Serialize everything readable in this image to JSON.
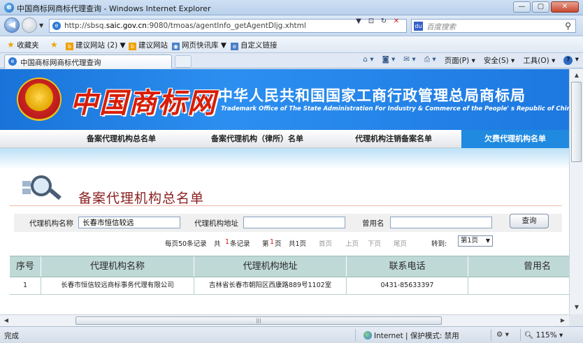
{
  "window": {
    "title": "中国商标网商标代理查询 - Windows Internet Explorer",
    "minimize": "—",
    "restore": "▢",
    "close": "✕"
  },
  "address": {
    "url_prefix": "http://sbsq.",
    "url_host": "saic.gov.cn",
    "url_rest": ":9080/tmoas/agentInfo_getAgentDljg.xhtml",
    "search_placeholder": "百度搜索"
  },
  "favorites": {
    "favorites_label": "收藏夹",
    "items": [
      {
        "label": "建议网站 (2)",
        "icon": "b-icon",
        "dropdown": true
      },
      {
        "label": "建议网站",
        "icon": "b-icon",
        "dropdown": false
      },
      {
        "label": "网页快讯库",
        "icon": "web-slice-icon",
        "dropdown": true
      },
      {
        "label": "自定义链接",
        "icon": "page-icon",
        "dropdown": false
      }
    ]
  },
  "tabs": [
    {
      "label": "中国商标网商标代理查询",
      "active": true
    }
  ],
  "command_bar": {
    "page": "页面(P)",
    "safety": "安全(S)",
    "tools": "工具(O)"
  },
  "site": {
    "logo_text": "中国商标网",
    "title_cn": "中华人民共和国国家工商行政管理总局商标局",
    "title_en": "Trademark Office of The State Administration For Industry & Commerce of the People' s Republic of China",
    "nav": [
      {
        "label": "备案代理机构总名单",
        "active": false
      },
      {
        "label": "备案代理机构（律所）名单",
        "active": false
      },
      {
        "label": "代理机构注销备案名单",
        "active": false
      },
      {
        "label": "欠费代理机构名单",
        "active": true
      }
    ]
  },
  "section": {
    "title": "备案代理机构总名单"
  },
  "form": {
    "name_label": "代理机构名称",
    "name_value": "长春市恒信较远",
    "address_label": "代理机构地址",
    "address_value": "",
    "former_label": "曾用名",
    "former_value": "",
    "query_button": "查询"
  },
  "pager": {
    "per_page_prefix": "每页50条记录",
    "total_prefix": "共",
    "total_count": "1",
    "total_suffix": "条记录",
    "current_prefix": "第",
    "current_page": "1",
    "current_suffix": "页",
    "total_pages": "共1页",
    "first": "首页",
    "prev": "上页",
    "next": "下页",
    "last": "尾页",
    "goto_label": "转到:",
    "goto_value": "第1页"
  },
  "table": {
    "headers": [
      "序号",
      "代理机构名称",
      "代理机构地址",
      "联系电话",
      "曾用名"
    ],
    "rows": [
      [
        "1",
        "长春市恒信较远商标事务代理有限公司",
        "吉林省长春市朝阳区西康路889号1102室",
        "0431-85633397",
        ""
      ]
    ]
  },
  "status": {
    "text": "完成",
    "zone": "Internet | 保护模式: 禁用",
    "zoom": "115%"
  }
}
